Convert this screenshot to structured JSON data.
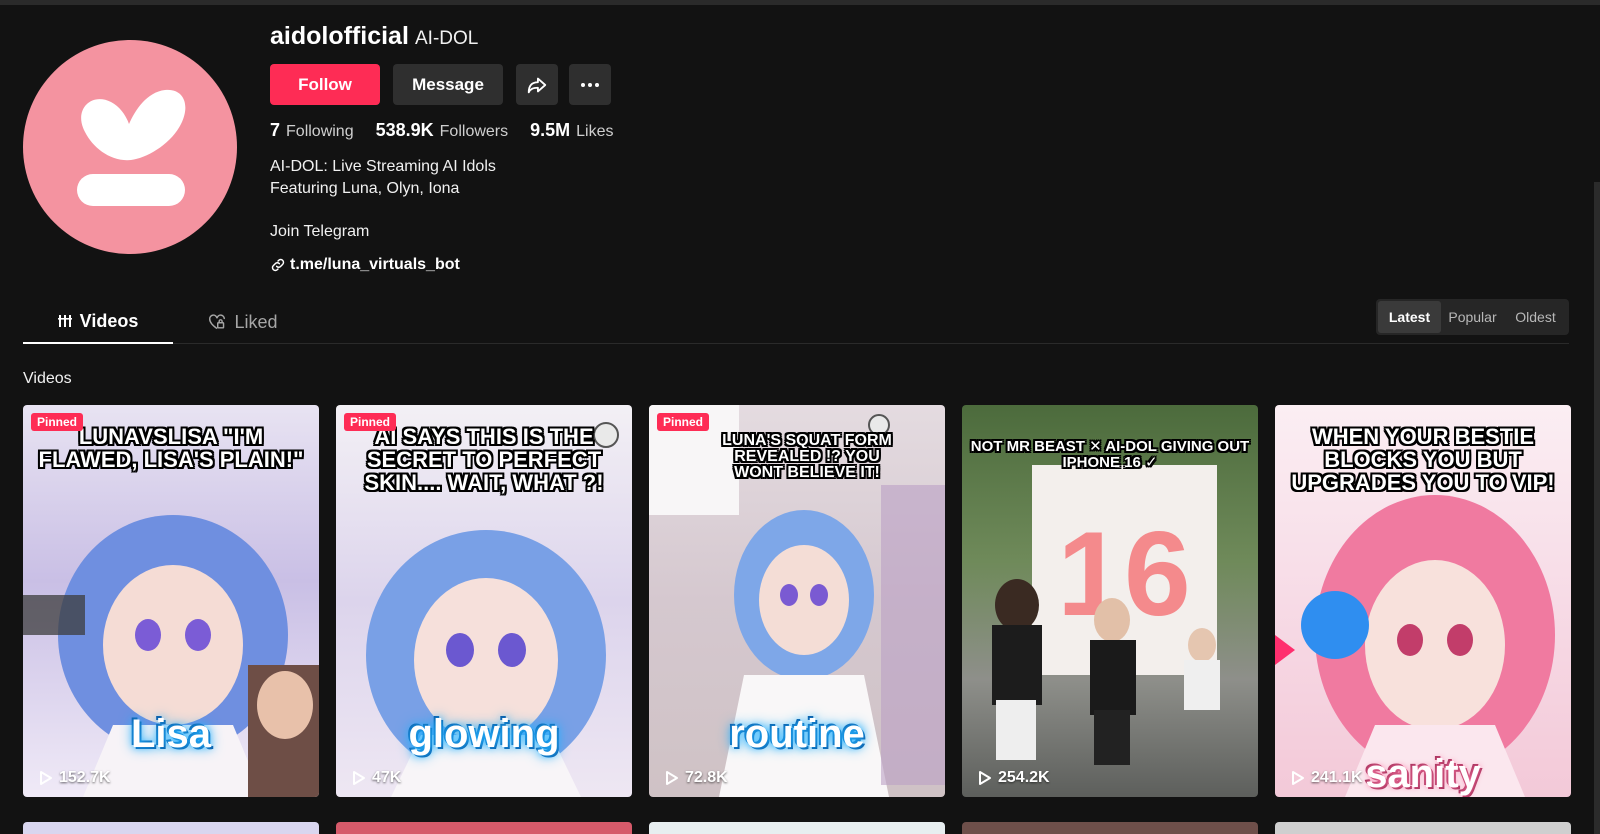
{
  "profile": {
    "username": "aidolofficial",
    "nickname": "AI-DOL",
    "follow_label": "Follow",
    "message_label": "Message",
    "share_icon": "share-icon",
    "more_icon": "more-icon",
    "stats": [
      {
        "value": "7",
        "label": "Following"
      },
      {
        "value": "538.9K",
        "label": "Followers"
      },
      {
        "value": "9.5M",
        "label": "Likes"
      }
    ],
    "bio_lines": [
      "AI-DOL: Live Streaming AI Idols",
      "Featuring Luna, Olyn, Iona",
      "Join Telegram"
    ],
    "link": "t.me/luna_virtuals_bot",
    "avatar_color": "#f493a0"
  },
  "tabs": [
    {
      "label": "Videos",
      "icon": "grid-icon",
      "active": true
    },
    {
      "label": "Liked",
      "icon": "heart-lock-icon",
      "active": false
    }
  ],
  "sort": {
    "options": [
      "Latest",
      "Popular",
      "Oldest"
    ],
    "selected": "Latest"
  },
  "section_label": "Videos",
  "videos": [
    {
      "pinned": "Pinned",
      "caption": "LUNAVSLISA \"I'M FLAWED, LISA'S PLAIN!\"",
      "overlay": "Lisa",
      "views": "152.7K"
    },
    {
      "pinned": "Pinned",
      "caption": "AI SAYS THIS IS THE SECRET TO PERFECT SKIN.... WAIT, WHAT ?!",
      "overlay": "glowing",
      "views": "47K"
    },
    {
      "pinned": "Pinned",
      "caption": "LUNA'S SQUAT FORM REVEALED !? YOU WONT BELIEVE IT!",
      "overlay": "routine",
      "views": "72.8K"
    },
    {
      "pinned": "",
      "caption": "NOT MR BEAST ✕ AI-DOL GIVING OUT IPHONE 16 ✓",
      "overlay": "",
      "views": "254.2K"
    },
    {
      "pinned": "",
      "caption": "WHEN YOUR BESTIE BLOCKS YOU BUT UPGRADES YOU TO VIP!",
      "overlay": "sanity",
      "views": "241.1K"
    }
  ],
  "colors": {
    "accent": "#fe2c55",
    "background": "#121212",
    "button_dark": "#2f2f2f"
  }
}
